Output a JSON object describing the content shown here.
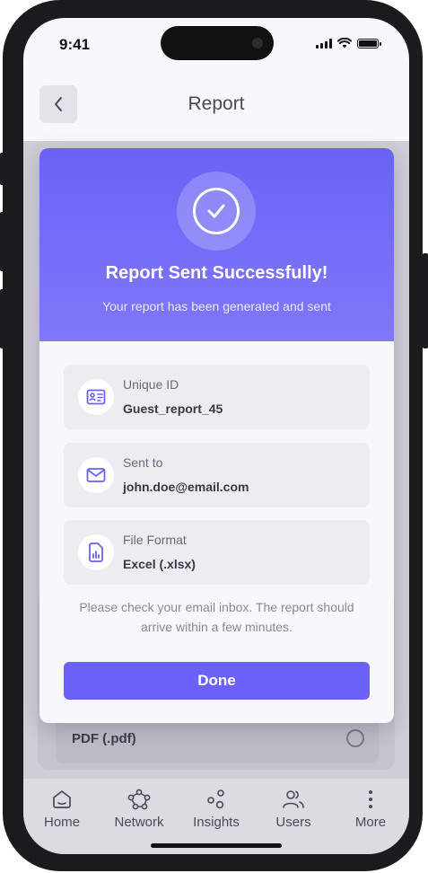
{
  "status_bar": {
    "time": "9:41"
  },
  "header": {
    "title": "Report"
  },
  "background": {
    "option_label": "PDF (.pdf)"
  },
  "modal": {
    "title": "Report Sent Successfully!",
    "subtitle": "Your report has been generated and sent",
    "items": [
      {
        "label": "Unique ID",
        "value": "Guest_report_45",
        "icon": "id-card-icon"
      },
      {
        "label": "Sent to",
        "value": "john.doe@email.com",
        "icon": "mail-icon"
      },
      {
        "label": "File Format",
        "value": "Excel (.xlsx)",
        "icon": "file-chart-icon"
      }
    ],
    "note_line1": "Please check your email inbox. The report should",
    "note_line2": "arrive within a few minutes.",
    "done_label": "Done"
  },
  "nav": {
    "items": [
      {
        "label": "Home",
        "icon": "home-icon"
      },
      {
        "label": "Network",
        "icon": "network-icon"
      },
      {
        "label": "Insights",
        "icon": "insights-icon"
      },
      {
        "label": "Users",
        "icon": "users-icon"
      },
      {
        "label": "More",
        "icon": "more-icon"
      }
    ]
  },
  "colors": {
    "accent": "#6a62f6",
    "header_gradient_end": "#7f78fa"
  }
}
